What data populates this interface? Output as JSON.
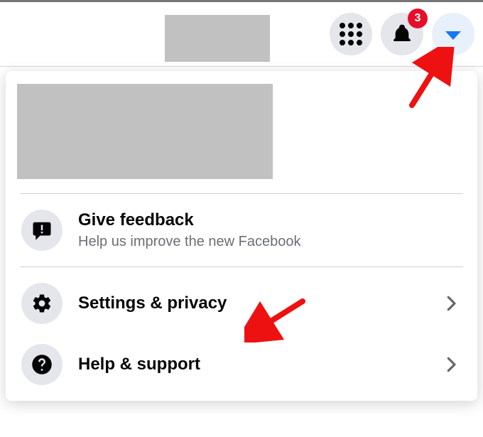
{
  "header": {
    "notification_badge": "3"
  },
  "menu": {
    "feedback": {
      "title": "Give feedback",
      "subtitle": "Help us improve the new Facebook"
    },
    "settings": {
      "title": "Settings & privacy"
    },
    "help": {
      "title": "Help & support"
    }
  }
}
